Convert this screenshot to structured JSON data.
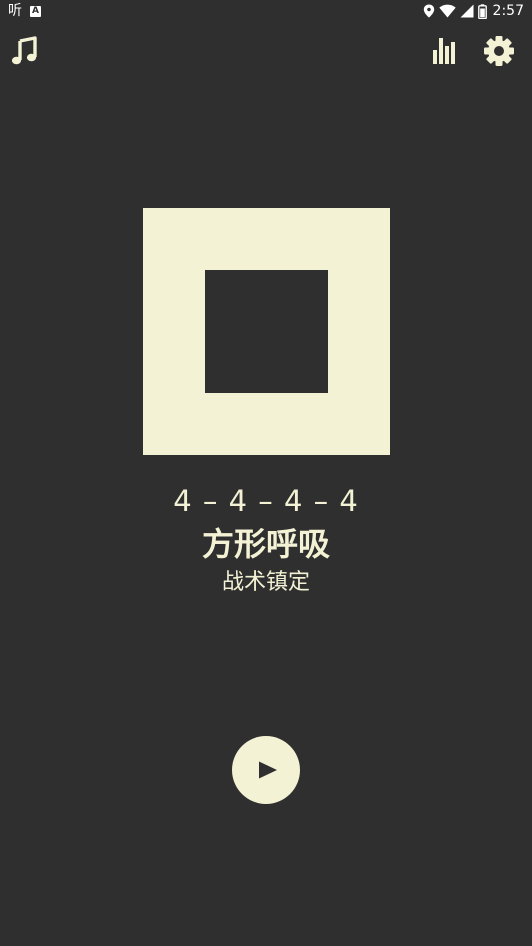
{
  "status_bar": {
    "app_label": "听",
    "notification_badge": "A",
    "time": "2:57",
    "icons": [
      "location-icon",
      "wifi-icon",
      "signal-icon",
      "battery-icon"
    ]
  },
  "toolbar": {
    "left_icon": "music-note-icon",
    "right_icons": [
      "bar-chart-icon",
      "gear-icon"
    ]
  },
  "colors": {
    "background": "#2f2f2f",
    "accent": "#f3f2d4"
  },
  "exercise": {
    "pattern": "4 – 4 – 4 – 4",
    "name": "方形呼吸",
    "subtitle": "战术镇定"
  },
  "controls": {
    "play_icon": "play-icon"
  }
}
